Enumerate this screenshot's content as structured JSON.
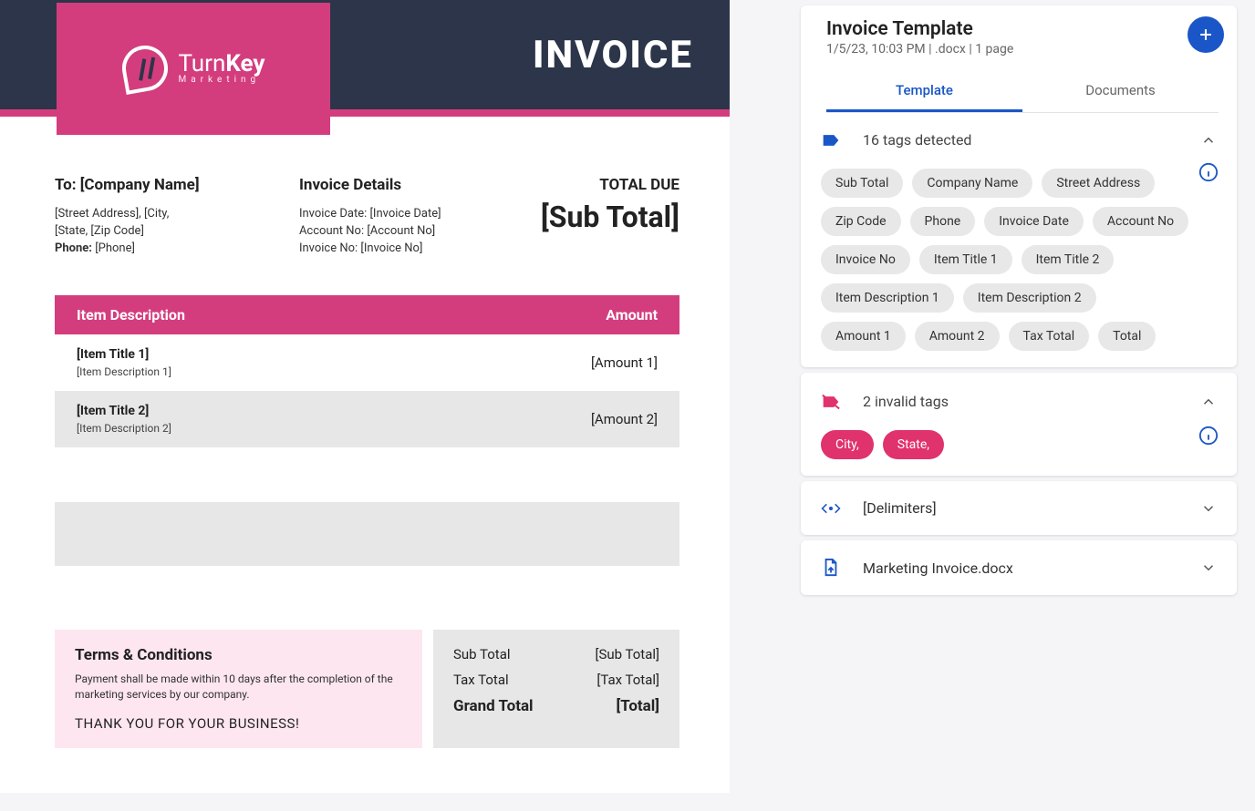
{
  "doc": {
    "brand": {
      "line1_a": "Turn",
      "line1_b": "Key",
      "line2": "Marketing"
    },
    "title": "INVOICE",
    "to_heading": "To: [Company Name]",
    "to_lines": {
      "l1": "[Street Address], [City,",
      "l2": "[State, [Zip Code]",
      "l3_label": "Phone:",
      "l3_value": "[Phone]"
    },
    "details_heading": "Invoice Details",
    "details": {
      "d1": "Invoice Date: [Invoice Date]",
      "d2": "Account No: [Account No]",
      "d3": "Invoice No: [Invoice No]"
    },
    "total_due_label": "TOTAL DUE",
    "total_due_value": "[Sub Total]",
    "items_header": {
      "desc": "Item Description",
      "amt": "Amount"
    },
    "items": [
      {
        "title": "[Item Title 1]",
        "desc": "[Item Description 1]",
        "amount": "[Amount 1]"
      },
      {
        "title": "[Item Title 2]",
        "desc": "[Item Description 2]",
        "amount": "[Amount 2]"
      }
    ],
    "terms": {
      "heading": "Terms & Conditions",
      "body": "Payment shall be made within 10 days after the completion of the marketing services by our company.",
      "thanks": "THANK YOU FOR YOUR BUSINESS!"
    },
    "totals": {
      "sub_label": "Sub Total",
      "sub_value": "[Sub Total]",
      "tax_label": "Tax Total",
      "tax_value": "[Tax Total]",
      "grand_label": "Grand Total",
      "grand_value": "[Total]"
    }
  },
  "panel": {
    "title": "Invoice Template",
    "meta": "1/5/23, 10:03 PM | .docx | 1 page",
    "tabs": {
      "template": "Template",
      "documents": "Documents"
    },
    "detected": {
      "summary": "16 tags detected",
      "tags": [
        "Sub Total",
        "Company Name",
        "Street Address",
        "Zip Code",
        "Phone",
        "Invoice Date",
        "Account No",
        "Invoice No",
        "Item Title 1",
        "Item Title 2",
        "Item Description 1",
        "Item Description 2",
        "Amount 1",
        "Amount 2",
        "Tax Total",
        "Total"
      ]
    },
    "invalid": {
      "summary": "2 invalid tags",
      "tags": [
        "City,",
        "State,"
      ]
    },
    "delimiters_label": "[Delimiters]",
    "file_label": "Marketing Invoice.docx"
  }
}
